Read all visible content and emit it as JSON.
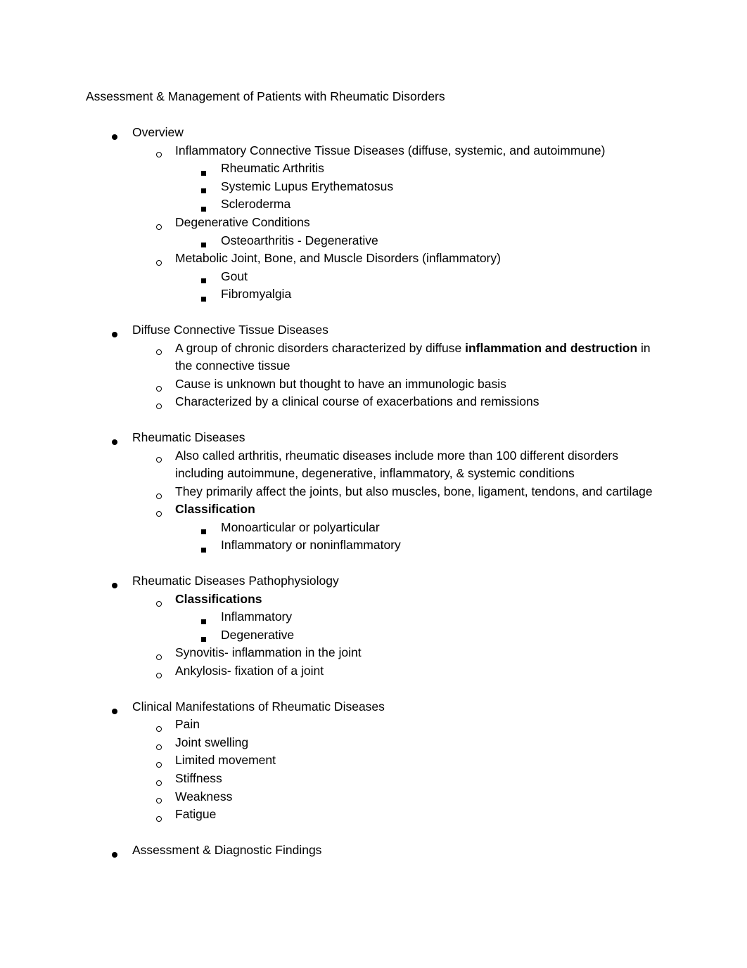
{
  "document": {
    "title": "Assessment & Management of Patients with Rheumatic Disorders",
    "text_color": "#000000",
    "background_color": "#ffffff",
    "sections": [
      {
        "heading": "Overview",
        "children": [
          {
            "text": "Inflammatory Connective Tissue Diseases (diffuse, systemic, and autoimmune)",
            "children": [
              {
                "text": "Rheumatic Arthritis"
              },
              {
                "text": "Systemic Lupus Erythematosus"
              },
              {
                "text": "Scleroderma"
              }
            ]
          },
          {
            "text": "Degenerative Conditions",
            "children": [
              {
                "text": "Osteoarthritis - Degenerative"
              }
            ]
          },
          {
            "text": "Metabolic Joint, Bone, and Muscle Disorders (inflammatory)",
            "children": [
              {
                "text": "Gout"
              },
              {
                "text": "Fibromyalgia"
              }
            ]
          }
        ]
      },
      {
        "heading": "Diffuse Connective Tissue Diseases",
        "children": [
          {
            "rich": [
              {
                "t": "A group of chronic disorders characterized by diffuse ",
                "b": false
              },
              {
                "t": "inflammation and destruction",
                "b": true
              },
              {
                "t": " in the connective tissue",
                "b": false
              }
            ]
          },
          {
            "text": "Cause is unknown but thought to have an immunologic basis"
          },
          {
            "text": "Characterized by a clinical course of exacerbations and remissions"
          }
        ]
      },
      {
        "heading": "Rheumatic Diseases",
        "children": [
          {
            "text": "Also called arthritis, rheumatic diseases include more than 100 different disorders including autoimmune, degenerative, inflammatory, & systemic conditions"
          },
          {
            "text": "They primarily affect the joints, but also muscles, bone, ligament, tendons, and cartilage"
          },
          {
            "rich": [
              {
                "t": "Classification",
                "b": true
              }
            ],
            "children": [
              {
                "text": "Monoarticular or polyarticular"
              },
              {
                "text": "Inflammatory or noninflammatory"
              }
            ]
          }
        ]
      },
      {
        "heading": "Rheumatic Diseases Pathophysiology",
        "children": [
          {
            "rich": [
              {
                "t": "Classifications",
                "b": true
              }
            ],
            "children": [
              {
                "text": "Inflammatory"
              },
              {
                "text": "Degenerative"
              }
            ]
          },
          {
            "text": "Synovitis- inflammation in the joint"
          },
          {
            "text": "Ankylosis- fixation of a joint"
          }
        ]
      },
      {
        "heading": "Clinical Manifestations of Rheumatic Diseases",
        "children": [
          {
            "text": "Pain"
          },
          {
            "text": "Joint swelling"
          },
          {
            "text": "Limited movement"
          },
          {
            "text": "Stiffness"
          },
          {
            "text": "Weakness"
          },
          {
            "text": "Fatigue"
          }
        ]
      },
      {
        "heading": "Assessment & Diagnostic Findings",
        "children": []
      }
    ]
  }
}
